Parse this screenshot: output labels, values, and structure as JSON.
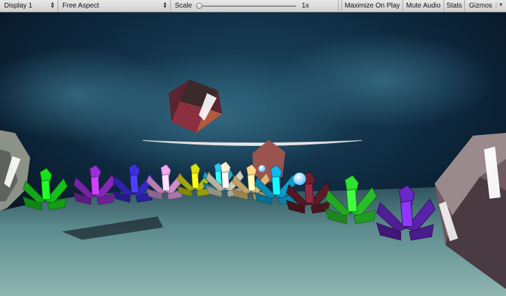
{
  "toolbar": {
    "display": {
      "label": "Display 1"
    },
    "aspect": {
      "label": "Free Aspect"
    },
    "scale": {
      "label": "Scale",
      "value_label": "1x",
      "value": 0.0
    },
    "maximize_on_play": "Maximize On Play",
    "mute_audio": "Mute Audio",
    "stats": "Stats",
    "gizmos": "Gizmos"
  },
  "icons": {
    "dropdown": "up-down-arrow-icon",
    "gizmos_menu": "triangle-down-icon"
  },
  "colors": {
    "toolbar_bg": "#d9d9d9",
    "sky": "#0b1e33",
    "ground": "#5a8a8c"
  },
  "scene": {
    "crystals": [
      {
        "name": "green-crystal",
        "color": "#19e020"
      },
      {
        "name": "purple-crystal",
        "color": "#9b2fd9"
      },
      {
        "name": "blue-crystal",
        "color": "#3b2fe0"
      },
      {
        "name": "pink-crystal",
        "color": "#f0a8f0"
      },
      {
        "name": "yellow-crystal",
        "color": "#d8e010"
      },
      {
        "name": "cyan-crystal",
        "color": "#28c8f0"
      },
      {
        "name": "white-crystal",
        "color": "#f6f0d8"
      },
      {
        "name": "peach-crystal",
        "color": "#ffd88a"
      },
      {
        "name": "aqua-crystal",
        "color": "#10b8f0"
      },
      {
        "name": "maroon-crystal",
        "color": "#6a2030"
      },
      {
        "name": "lime-crystal",
        "color": "#30e030"
      },
      {
        "name": "violet-crystal",
        "color": "#6a28c8"
      }
    ]
  }
}
